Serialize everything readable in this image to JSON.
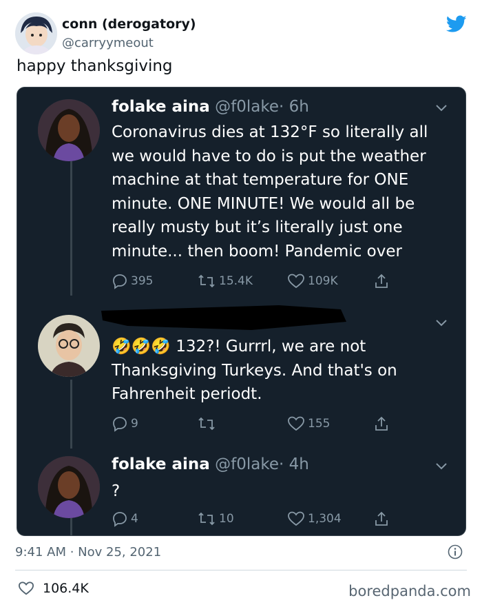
{
  "tweet": {
    "author_name": "conn (derogatory)",
    "author_handle": "@carryymeout",
    "text": "happy thanksgiving",
    "timestamp": "9:41 AM · Nov 25, 2021",
    "likes": "106.4K"
  },
  "embedded": {
    "tweets": [
      {
        "name": "folake aina",
        "handle": "@f0lake",
        "time": "· 6h",
        "body": "Coronavirus dies at 132°F so literally all we would have to do is put the weather machine at that temperature for ONE minute. ONE MINUTE! We would all be really musty but it’s literally just one minute... then boom! Pandemic over",
        "replies": "395",
        "retweets": "15.4K",
        "likes": "109K"
      },
      {
        "name": "",
        "handle": "",
        "time": "",
        "emoji": "🤣🤣🤣",
        "body": "132?! Gurrrl, we are not Thanksgiving Turkeys. And that's on Fahrenheit periodt.",
        "replies": "9",
        "retweets": "",
        "likes": "155"
      },
      {
        "name": "folake aina",
        "handle": "@f0lake",
        "time": "· 4h",
        "body": "?",
        "replies": "4",
        "retweets": "10",
        "likes": "1,304"
      }
    ]
  },
  "watermark": "boredpanda.com",
  "icons": {
    "brand": "twitter-bird-icon",
    "brand_color": "#1d9bf0",
    "card_bg": "#15202b"
  }
}
